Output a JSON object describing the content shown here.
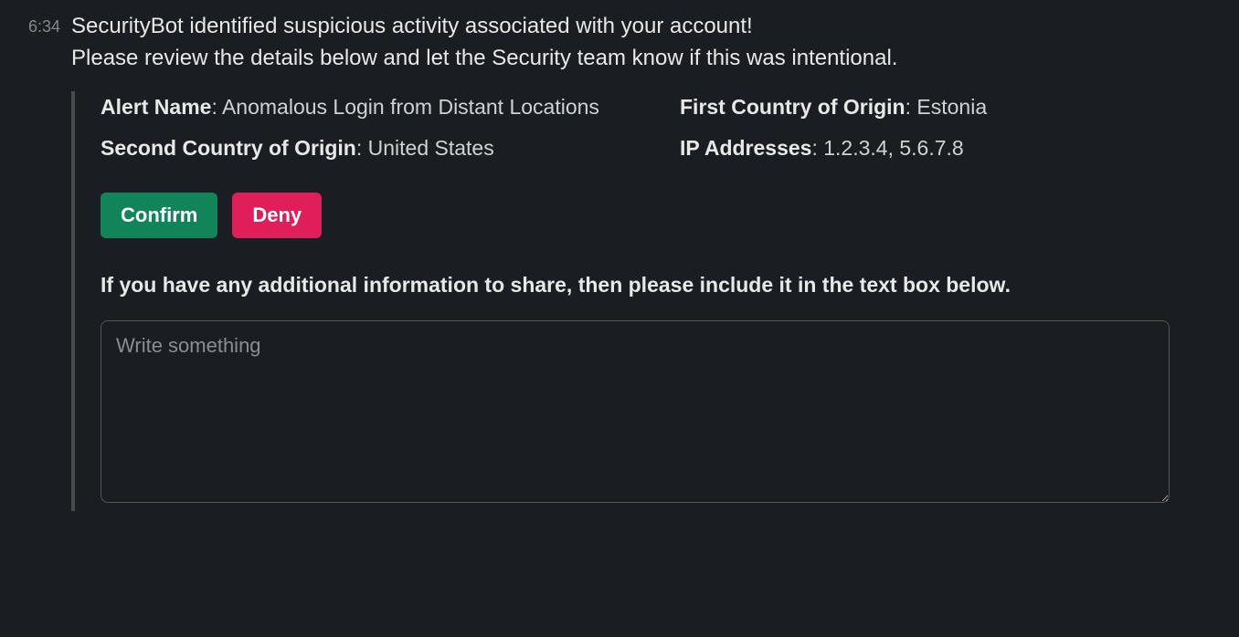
{
  "timestamp": "6:34",
  "heading_line1": "SecurityBot identified suspicious activity associated with your account!",
  "heading_line2": "Please review the details below and let the Security team know if this was intentional.",
  "fields": {
    "alert_name": {
      "label": "Alert Name",
      "value": "Anomalous Login from Distant Locations"
    },
    "first_country": {
      "label": "First Country of Origin",
      "value": "Estonia"
    },
    "second_country": {
      "label": "Second Country of Origin",
      "value": "United States"
    },
    "ip_addresses": {
      "label": "IP Addresses",
      "value": "1.2.3.4, 5.6.7.8"
    }
  },
  "buttons": {
    "confirm": "Confirm",
    "deny": "Deny"
  },
  "prompt": "If you have any additional information to share, then please include it in the text box below.",
  "textarea": {
    "placeholder": "Write something",
    "value": ""
  }
}
